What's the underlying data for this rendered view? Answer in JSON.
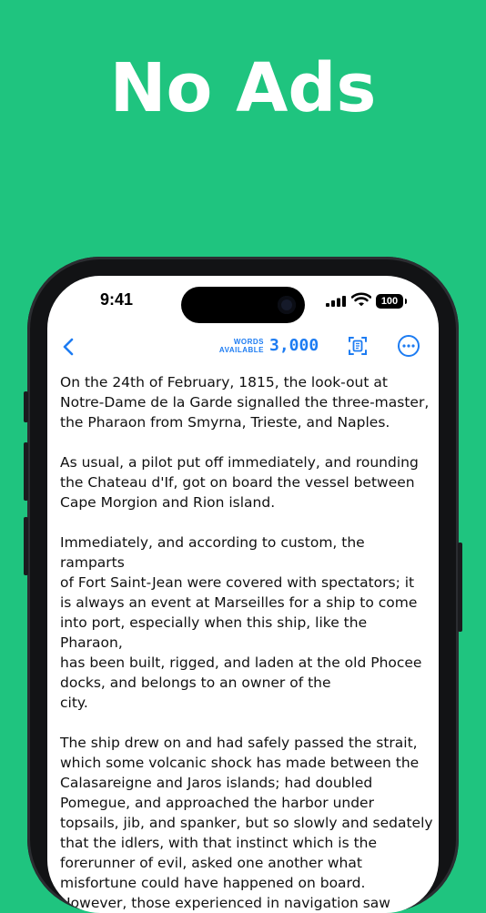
{
  "headline": "No Ads",
  "status_bar": {
    "time": "9:41",
    "battery": "100"
  },
  "toolbar": {
    "words_label_line1": "WORDS",
    "words_label_line2": "AVAILABLE",
    "words_count": "3,000"
  },
  "icons": {
    "back": "chevron-left-icon",
    "copy": "copy-document-icon",
    "more": "ellipsis-circle-icon",
    "signal": "cellular-signal-icon",
    "wifi": "wifi-icon"
  },
  "colors": {
    "background": "#1fc47f",
    "accent": "#1d7cf2"
  },
  "paragraphs": [
    [
      "On the 24th of February, 1815, the look-out at",
      "Notre-Dame de la Garde signalled the three-master,",
      "the Pharaon from Smyrna, Trieste, and Naples."
    ],
    [
      "As usual, a pilot put off immediately, and rounding",
      "the Chateau d'If, got on board the vessel between",
      "Cape Morgion and Rion island."
    ],
    [
      "Immediately, and according to custom, the ramparts",
      "of Fort Saint-Jean were covered with spectators; it",
      "is always an event at Marseilles for a ship to come",
      "into port, especially when this ship, like the Pharaon,",
      "has been built, rigged, and laden at the old Phocee",
      "docks, and belongs to an owner of the",
      "city."
    ],
    [
      "The ship drew on and had safely passed the strait,",
      "which some volcanic shock has made between the",
      "Calasareigne and Jaros islands; had doubled",
      "Pomegue, and approached the harbor under",
      "topsails, jib, and spanker, but so slowly and sedately",
      "that the idlers, with that instinct which is the",
      "forerunner of evil, asked one another what",
      "misfortune could have happened on board.",
      "However, those experienced in navigation saw"
    ]
  ]
}
